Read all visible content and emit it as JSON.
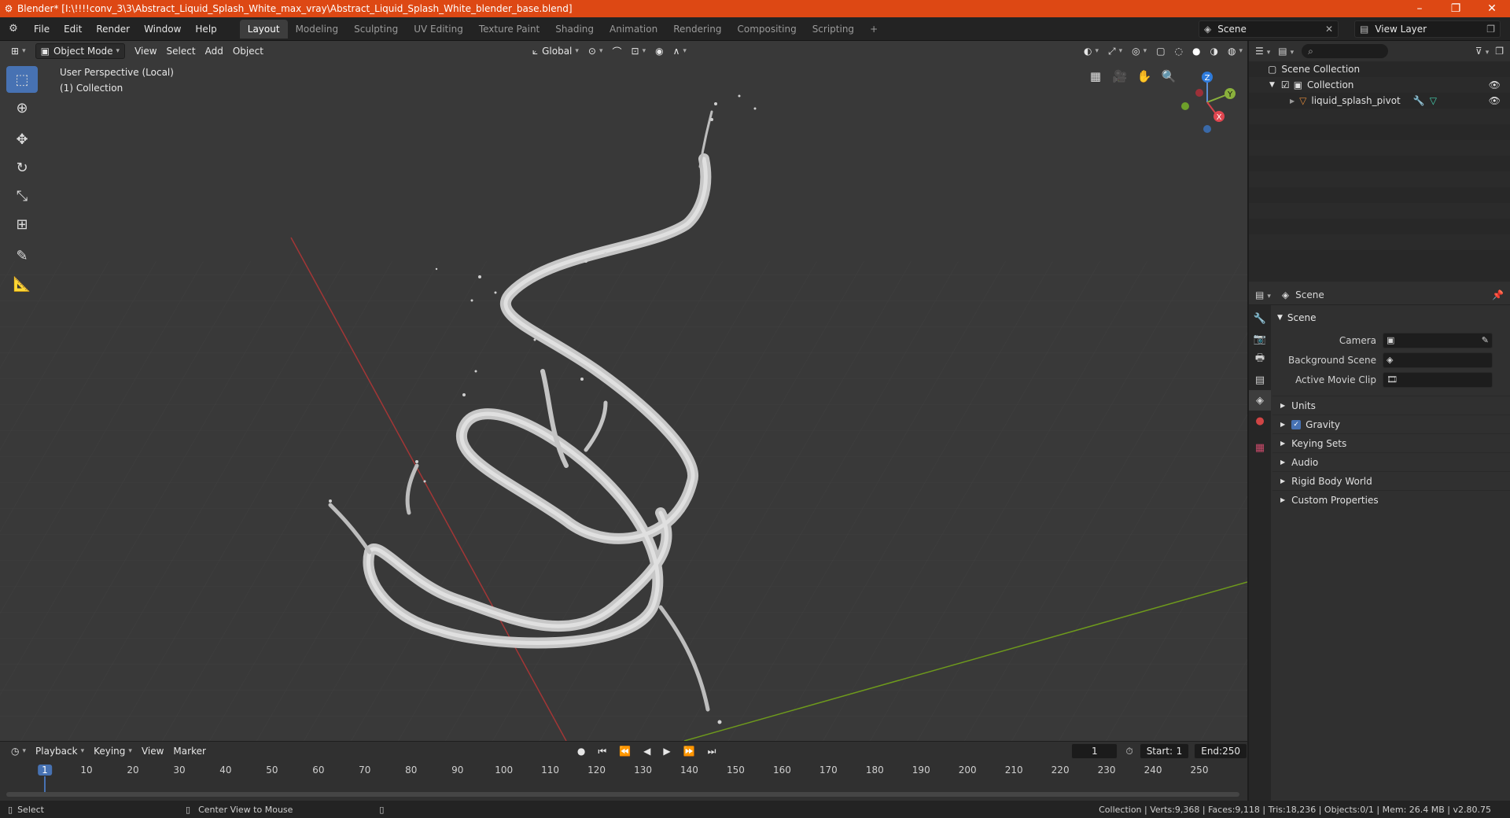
{
  "window": {
    "title": "Blender* [I:\\!!!!conv_3\\3\\Abstract_Liquid_Splash_White_max_vray\\Abstract_Liquid_Splash_White_blender_base.blend]",
    "minimize": "–",
    "maximize": "❐",
    "close": "✕"
  },
  "menu": [
    "File",
    "Edit",
    "Render",
    "Window",
    "Help"
  ],
  "workspaces": [
    "Layout",
    "Modeling",
    "Sculpting",
    "UV Editing",
    "Texture Paint",
    "Shading",
    "Animation",
    "Rendering",
    "Compositing",
    "Scripting"
  ],
  "scene_selector": "Scene",
  "view_layer": "View Layer",
  "viewport": {
    "mode": "Object Mode",
    "menus": [
      "View",
      "Select",
      "Add",
      "Object"
    ],
    "transform_orientation": "Global",
    "perspective_label": "User Perspective (Local)",
    "collection_label": "(1) Collection"
  },
  "gizmo": {
    "z": "Z",
    "y": "Y",
    "x": "X"
  },
  "outliner": {
    "search_placeholder": "",
    "root": "Scene Collection",
    "collection": "Collection",
    "object": "liquid_splash_pivot"
  },
  "properties": {
    "context": "Scene",
    "panel_title": "Scene",
    "camera_label": "Camera",
    "background_scene_label": "Background Scene",
    "active_movie_clip_label": "Active Movie Clip",
    "subpanels": [
      "Units",
      "Gravity",
      "Keying Sets",
      "Audio",
      "Rigid Body World",
      "Custom Properties"
    ]
  },
  "timeline": {
    "menus": [
      "Playback",
      "Keying",
      "View",
      "Marker"
    ],
    "current_frame": "1",
    "start_label": "Start:",
    "start_value": "1",
    "end_label": "End:",
    "end_value": "250",
    "ruler": [
      "1",
      "10",
      "20",
      "30",
      "40",
      "50",
      "60",
      "70",
      "80",
      "90",
      "100",
      "110",
      "120",
      "130",
      "140",
      "150",
      "160",
      "170",
      "180",
      "190",
      "200",
      "210",
      "220",
      "230",
      "240",
      "250"
    ]
  },
  "status": {
    "select": "Select",
    "center_view": "Center View to Mouse",
    "stats": "Collection | Verts:9,368 | Faces:9,118 | Tris:18,236 | Objects:0/1 | Mem: 26.4 MB | v2.80.75"
  },
  "colors": {
    "title_bar": "#dd4814",
    "active_blue": "#4772b3",
    "x_axis": "#c23a3a",
    "y_axis": "#7aa41f",
    "splash": "#c9c9c9"
  }
}
